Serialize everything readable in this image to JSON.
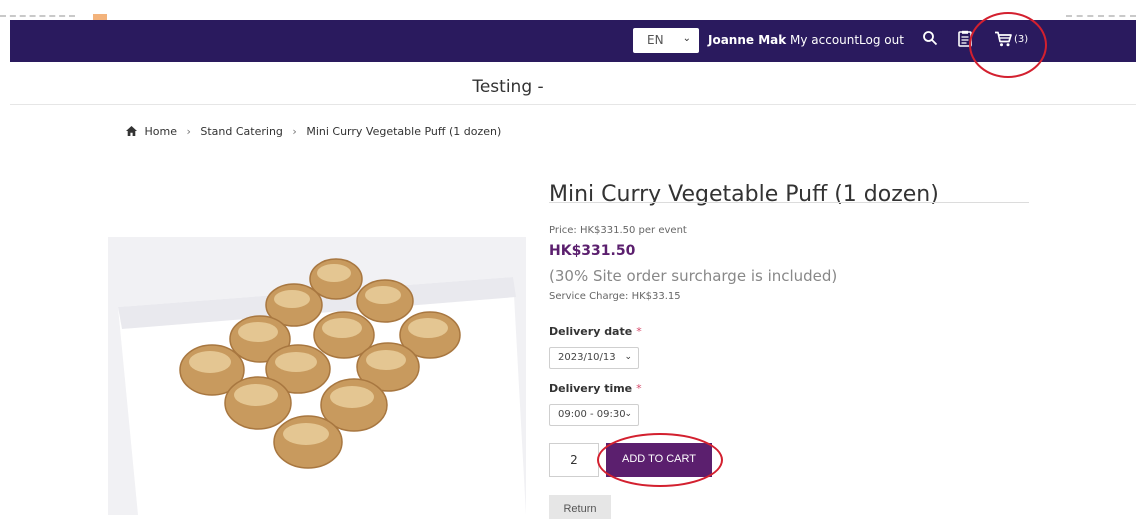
{
  "topbar": {
    "language": "EN",
    "user_name": "Joanne Mak",
    "my_account": "My account",
    "logout": "Log out",
    "cart_count": "(3)",
    "bg_color": "#2a1a5e"
  },
  "site": {
    "title": "Testing -"
  },
  "breadcrumb": {
    "home": "Home",
    "category": "Stand Catering",
    "current": "Mini Curry Vegetable Puff (1 dozen)"
  },
  "product": {
    "title": "Mini Curry Vegetable Puff (1 dozen)",
    "price_line": "Price: HK$331.50 per event",
    "price": "HK$331.50",
    "surcharge_note": "(30% Site order surcharge is included)",
    "service_charge": "Service Charge: HK$33.15",
    "accent_color": "#5b1f6e"
  },
  "form": {
    "delivery_date_label": "Delivery date",
    "delivery_date_value": "2023/10/13",
    "delivery_time_label": "Delivery time",
    "delivery_time_value": "09:00 - 09:30",
    "required_mark": "*",
    "quantity": "2",
    "add_to_cart": "ADD TO CART",
    "return": "Return"
  },
  "icons": {
    "search": "search-icon",
    "orders": "clipboard-icon",
    "cart": "cart-icon",
    "home": "home-icon",
    "chevron": "chevron-down-icon"
  }
}
